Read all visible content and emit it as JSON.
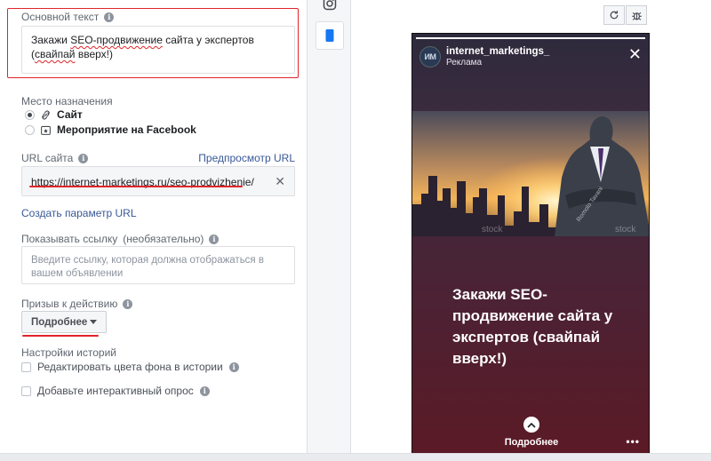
{
  "form": {
    "primary_text": {
      "label": "Основной текст",
      "value_line1_a": "Закажи ",
      "value_line1_b": "SEO-продвижение",
      "value_line1_c": " сайта у экспертов",
      "value_line2_a": "(",
      "value_line2_b": "свайпай",
      "value_line2_c": " вверх!)"
    },
    "destination": {
      "label": "Место назначения",
      "options": [
        {
          "label": "Сайт",
          "selected": true
        },
        {
          "label": "Мероприятие на Facebook",
          "selected": false
        }
      ]
    },
    "url": {
      "label": "URL сайта",
      "preview_link": "Предпросмотр URL",
      "value": "https://internet-marketings.ru/seo-prodvizhenie/",
      "clear_icon": "close-icon"
    },
    "create_param_link": "Создать параметр URL",
    "display_link": {
      "label": "Показывать ссылку",
      "optional": "(необязательно)",
      "placeholder": "Введите ссылку, которая должна отображаться в вашем объявлении"
    },
    "cta": {
      "label": "Призыв к действию",
      "selected": "Подробнее"
    },
    "stories_settings": {
      "label": "Настройки историй",
      "options": [
        {
          "label": "Редактировать цвета фона в истории",
          "checked": false
        },
        {
          "label": "Добавьте интерактивный опрос",
          "checked": false
        }
      ]
    }
  },
  "placements": {
    "tabs": [
      {
        "icon": "instagram-icon",
        "active": false
      },
      {
        "icon": "phone-stories-icon",
        "active": true
      }
    ]
  },
  "preview": {
    "toolbar": {
      "refresh_icon": "refresh-icon",
      "debug_icon": "bug-icon"
    },
    "story": {
      "progress": 1.0,
      "account_initials": "ИМ",
      "account_name": "internet_marketings_",
      "sponsored": "Реклама",
      "text": "Закажи SEO-продвижение сайта у экспертов (свайпай вверх!)",
      "cta": "Подробнее",
      "more": "•••"
    }
  },
  "colors": {
    "accent_link": "#385898",
    "highlight_red": "#e0242a"
  }
}
